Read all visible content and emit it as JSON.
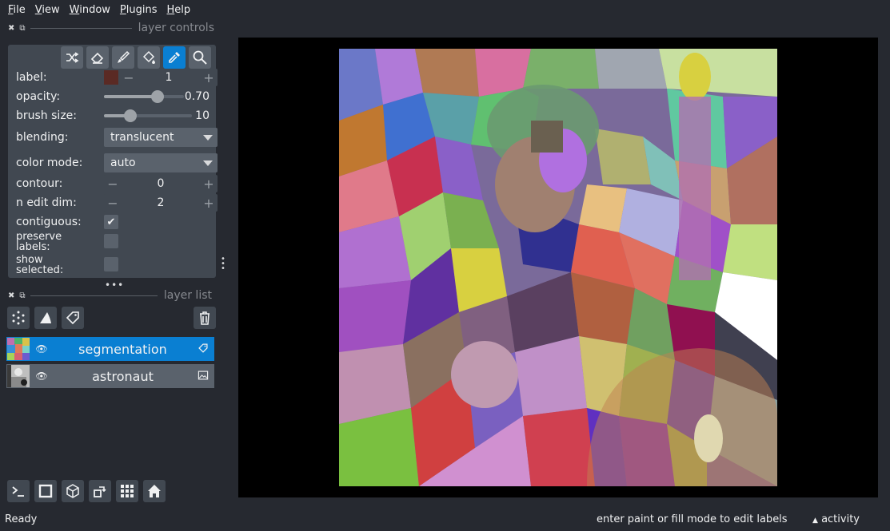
{
  "menu": [
    {
      "first": "F",
      "rest": "ile"
    },
    {
      "first": "V",
      "rest": "iew"
    },
    {
      "first": "W",
      "rest": "indow"
    },
    {
      "first": "P",
      "rest": "lugins"
    },
    {
      "first": "H",
      "rest": "elp"
    }
  ],
  "dock": {
    "controls_title": "layer controls",
    "list_title": "layer list"
  },
  "controls": {
    "label": {
      "text": "label:",
      "value": "1",
      "color": "#5a2a24"
    },
    "opacity": {
      "text": "opacity:",
      "value": "0.70",
      "fraction": 0.7
    },
    "brush_size": {
      "text": "brush size:",
      "value": "10",
      "fraction": 0.27
    },
    "blending": {
      "text": "blending:",
      "value": "translucent"
    },
    "color_mode": {
      "text": "color mode:",
      "value": "auto"
    },
    "contour": {
      "text": "contour:",
      "value": "0"
    },
    "n_edit_dim": {
      "text": "n edit dim:",
      "value": "2"
    },
    "contiguous": {
      "text": "contiguous:",
      "checked": true
    },
    "preserve_labels": {
      "text": "preserve labels:",
      "checked": false
    },
    "show_selected": {
      "text": "show selected:",
      "checked": false
    }
  },
  "tools": [
    "shuffle-icon",
    "eraser-icon",
    "paintbrush-icon",
    "fill-bucket-icon",
    "color-picker-icon",
    "zoom-icon"
  ],
  "layers": [
    {
      "name": "segmentation",
      "type": "labels",
      "selected": true
    },
    {
      "name": "astronaut",
      "type": "image",
      "selected": false
    }
  ],
  "status": {
    "left": "Ready",
    "mid": "enter paint or fill mode to edit labels",
    "right": "activity"
  }
}
